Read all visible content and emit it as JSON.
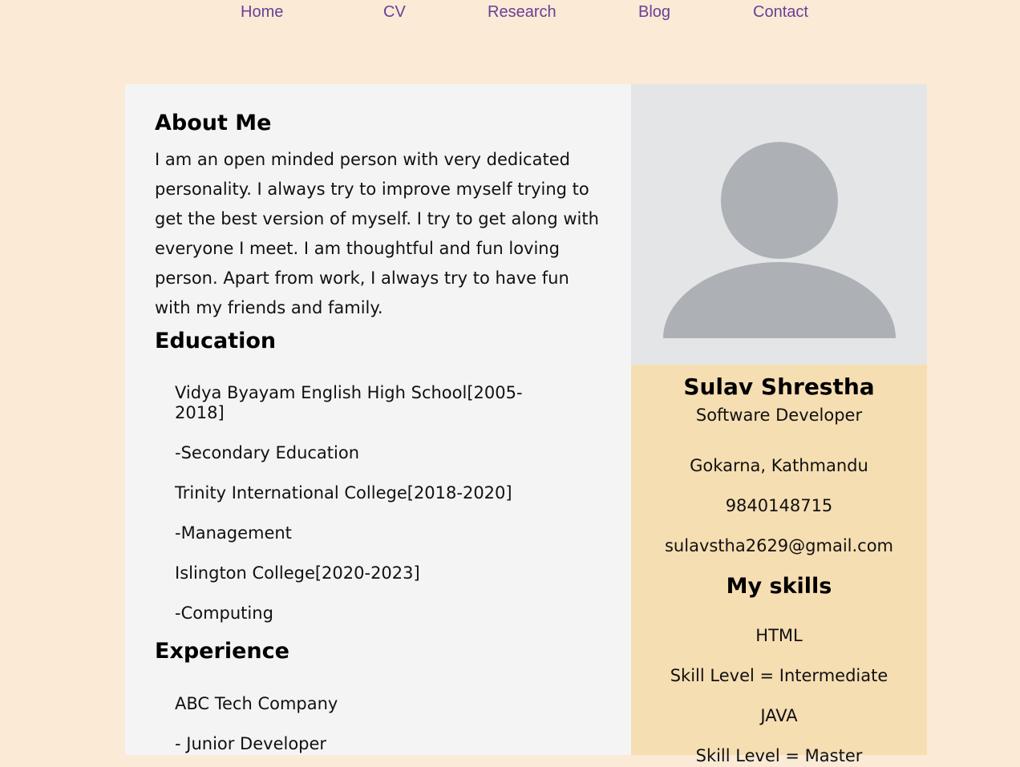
{
  "nav": {
    "items": [
      {
        "label": "Home"
      },
      {
        "label": "CV"
      },
      {
        "label": "Research"
      },
      {
        "label": "Blog"
      },
      {
        "label": "Contact"
      }
    ]
  },
  "about": {
    "title": "About Me",
    "text": "I am an open minded person with very dedicated personality. I always try to improve myself trying to get the best version of myself. I try to get along with everyone I meet. I am thoughtful and fun loving person. Apart from work, I always try to have fun with my friends and family."
  },
  "education": {
    "title": "Education",
    "entries": [
      "Vidya Byayam English High School[2005-2018]",
      "-Secondary Education",
      "Trinity International College[2018-2020]",
      "-Management",
      "Islington College[2020-2023]",
      "-Computing"
    ]
  },
  "experience": {
    "title": "Experience",
    "entries": [
      "ABC Tech Company",
      "- Junior Developer"
    ]
  },
  "profile": {
    "name": "Sulav Shrestha",
    "role": "Software Developer",
    "address": "Gokarna, Kathmandu",
    "phone": "9840148715",
    "email": "sulavstha2629@gmail.com"
  },
  "skills": {
    "title": "My skills",
    "items": [
      "HTML",
      "Skill Level = Intermediate",
      "JAVA",
      "Skill Level = Master"
    ]
  },
  "colors": {
    "page_background": "#faead6",
    "nav_link": "#6a3f96",
    "left_panel": "#f4f4f4",
    "right_panel": "#f6deb3",
    "avatar_background": "#e4e5e7",
    "avatar_figure": "#adb1b5"
  },
  "icons": {
    "avatar": "user-silhouette-icon"
  }
}
